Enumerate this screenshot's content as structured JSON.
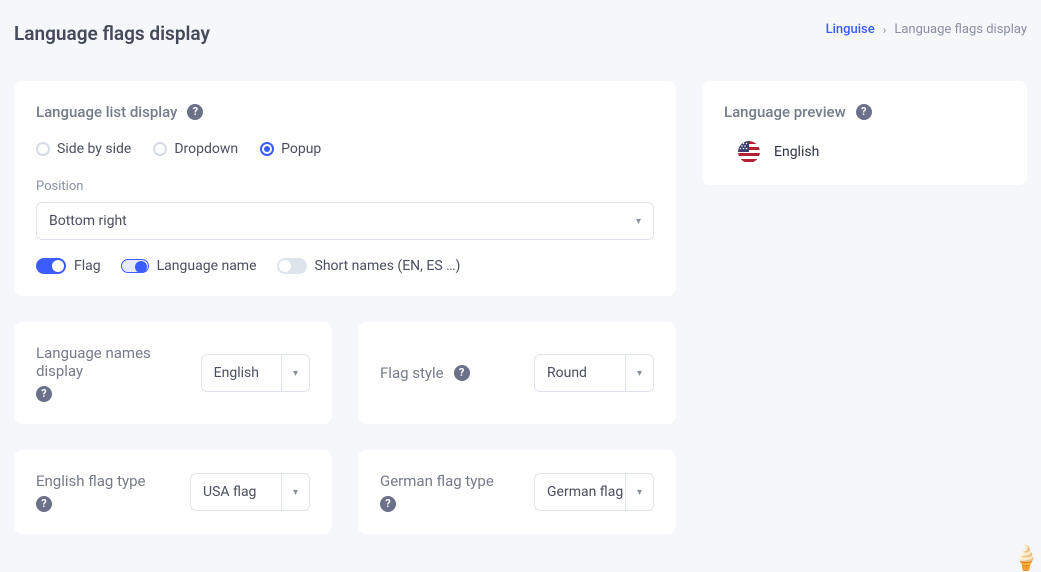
{
  "header": {
    "title": "Language flags display",
    "breadcrumb": {
      "home": "Linguise",
      "current": "Language flags display"
    }
  },
  "main_card": {
    "title": "Language list display",
    "radios": [
      {
        "label": "Side by side",
        "checked": false
      },
      {
        "label": "Dropdown",
        "checked": false
      },
      {
        "label": "Popup",
        "checked": true
      }
    ],
    "position_label": "Position",
    "position_value": "Bottom right",
    "toggles": [
      {
        "label": "Flag",
        "on": true,
        "variant": "solid"
      },
      {
        "label": "Language name",
        "on": true,
        "variant": "outline"
      },
      {
        "label": "Short names (EN, ES …)",
        "on": false,
        "variant": "solid"
      }
    ]
  },
  "preview": {
    "title": "Language preview",
    "language": "English"
  },
  "cards": {
    "names_display": {
      "label": "Language names display",
      "value": "English"
    },
    "flag_style": {
      "label": "Flag style",
      "value": "Round"
    },
    "english_flag": {
      "label": "English flag type",
      "value": "USA flag"
    },
    "german_flag": {
      "label": "German flag type",
      "value": "German flag"
    }
  }
}
